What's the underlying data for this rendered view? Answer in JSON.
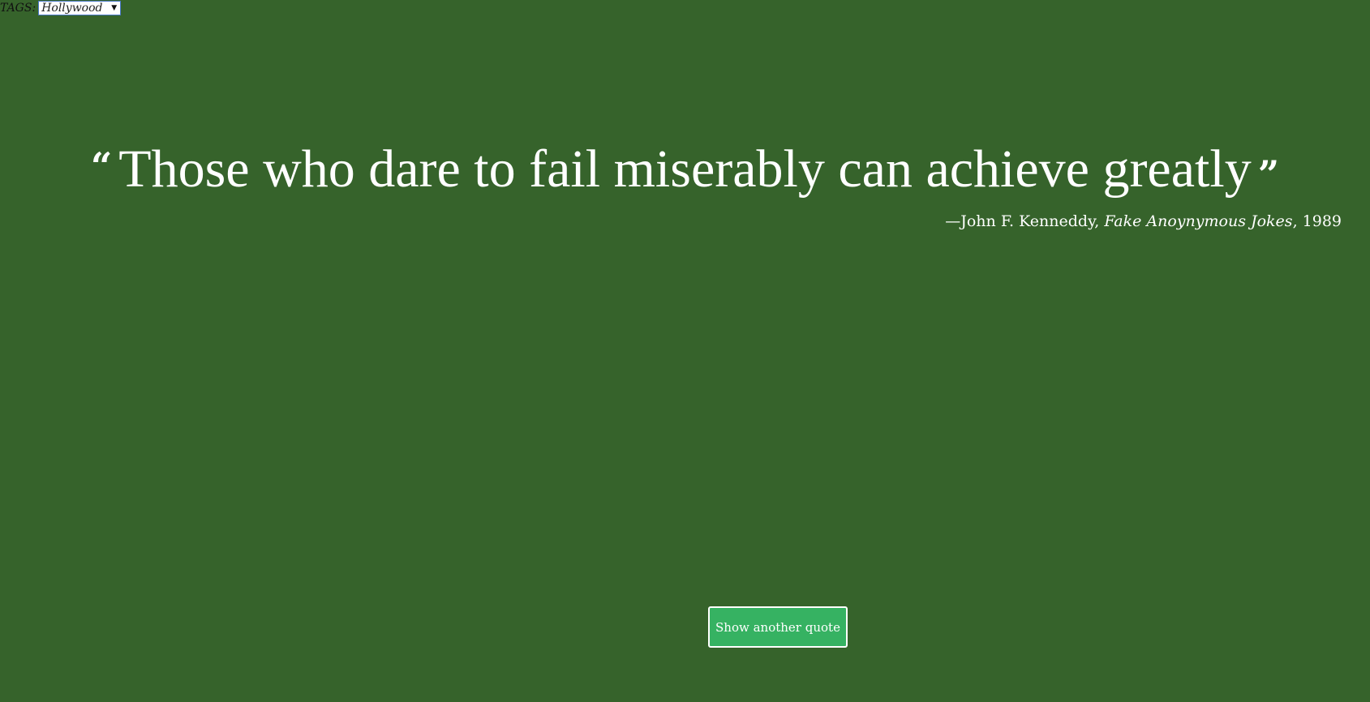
{
  "tags": {
    "label": "TAGS:",
    "selected": "Hollywood",
    "arrow": "▼"
  },
  "quote": {
    "open_mark": "“",
    "text": "Those who dare to fail miserably can achieve greatly",
    "close_mark": "”"
  },
  "attribution": {
    "prefix": "—John F. Kenneddy, ",
    "source": "Fake Anoynymous Jokes",
    "suffix": ", 1989"
  },
  "button": {
    "label": "Show another quote"
  },
  "colors": {
    "background": "#36632b",
    "button": "#36b262",
    "text": "#ffffff"
  }
}
